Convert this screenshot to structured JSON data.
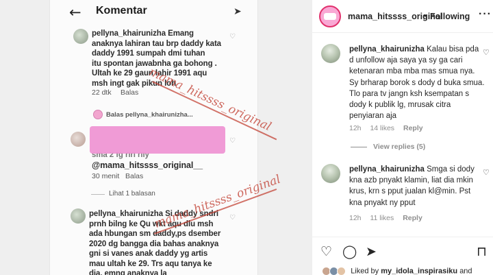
{
  "photo": {
    "header": {
      "back_icon": "arrow-left-icon",
      "title": "Komentar",
      "dm_icon": "paper-plane-icon"
    },
    "comment1": {
      "text_lines": [
        "pellyna_khairunizha Emang",
        "anaknya lahiran tau brp daddy kata",
        "daddy 1991 sumpah dmi tuhan",
        "itu spontan jawabnha ga bohong .",
        "Ultah ke 29 gaun lahir 1991 aqu",
        "msh ingt gak pikun loh"
      ],
      "time": "22 dtk",
      "reply": "Balas"
    },
    "reply_to": "Balas pellyna_khairunizha...",
    "comment2": {
      "text_lines": [
        "sma 2 fg rlrl rlly",
        "@mama_hitssss_original__"
      ],
      "time": "30 menit",
      "reply": "Balas"
    },
    "view_replies": "Lihat 1 balasan",
    "comment3": {
      "text_lines": [
        "pellyna_khairunizha Si daddy sndri",
        "prnh bilng ke Qu wkt aqu dlu msh",
        "ada hbungan sm daddy,ps dsember",
        "2020 dg bangga dia bahas anaknya",
        "gni si vanes anak daddy yg artis",
        "mau ultah ke 29. Trs aqu tanya ke",
        "dia, emng anaknya la"
      ]
    },
    "watermark": "mama_hitssss_original",
    "watermark_color": "#c0392b",
    "redaction_color": "#ef93d2"
  },
  "panel": {
    "header": {
      "username": "mama_hitssss_original",
      "separator": "•",
      "follow": "Following",
      "more_icon": "more-horizontal-icon"
    },
    "comments": [
      {
        "username": "pellyna_khairunizha",
        "text": "Kalau bisa pda d unfollow aja saya ya sy ga cari ketenaran mba mba mas smua nya. Sy brharap borok s dody d buka smua. Tlo para tv jangn ksh ksempatan s dody k publik lg, mrusak citra penyiaran aja",
        "time": "12h",
        "likes": "14 likes",
        "reply": "Reply",
        "view_replies": "View replies (5)"
      },
      {
        "username": "pellyna_khairunizha",
        "text": "Smga si dody kna azb pnyakt klamin, liat dia mkin krus, krn s pput jualan kl@min. Pst kna pnyakt ny pput",
        "time": "12h",
        "likes": "11 likes",
        "reply": "Reply"
      }
    ],
    "actions": {
      "like_icon": "heart-icon",
      "comment_icon": "comment-icon",
      "share_icon": "send-icon",
      "save_icon": "bookmark-icon"
    },
    "liked_by": {
      "prefix": "Liked by",
      "user": "my_idola_inspirasiku",
      "suffix": "and"
    },
    "accent_color": "#e1306c"
  }
}
